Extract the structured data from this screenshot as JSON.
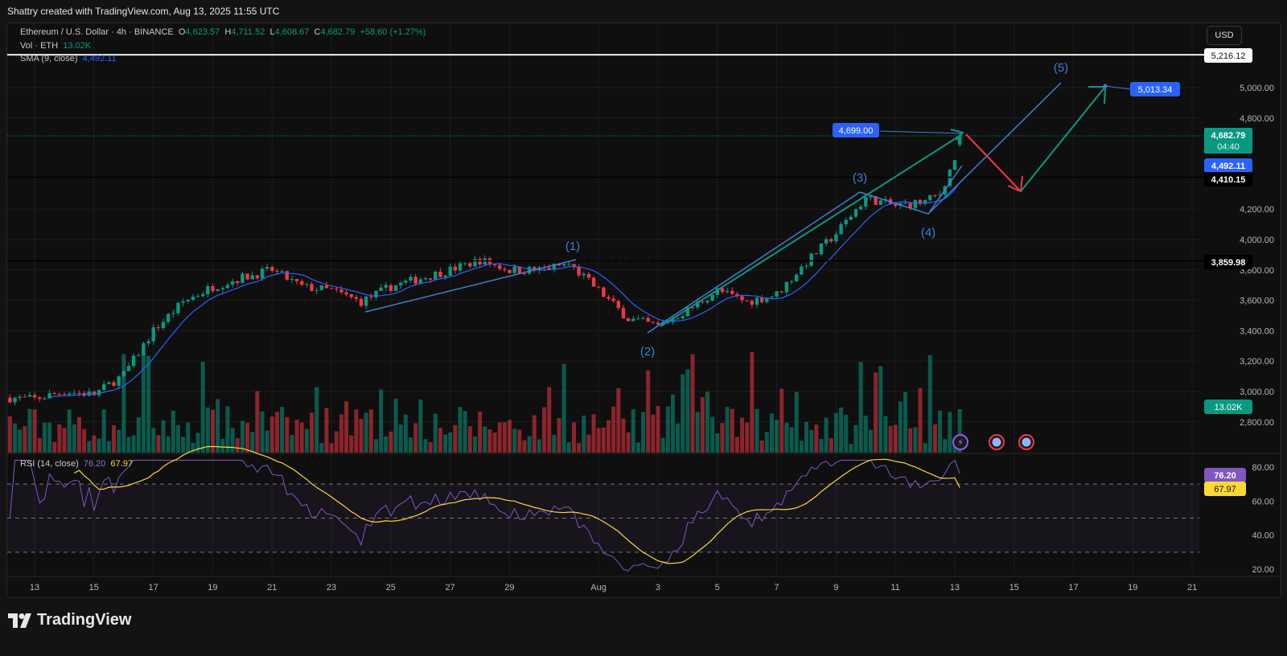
{
  "credit": "Shattry created with TradingView.com, Aug 13, 2025 11:55 UTC",
  "legend": {
    "symbol": "Ethereum / U.S. Dollar · 4h · BINANCE",
    "o_label": "O",
    "o": "4,623.57",
    "h_label": "H",
    "h": "4,711.52",
    "l_label": "L",
    "l": "4,608.67",
    "c_label": "C",
    "c": "4,682.79",
    "change": "+58.60 (+1.27%)",
    "vol_label": "Vol · ETH",
    "vol": "13.02K",
    "sma_label": "SMA (9, close)",
    "sma": "4,492.11",
    "rsi_label": "RSI (14, close)",
    "rsi": "76.20",
    "rsi_ma": "67.97"
  },
  "currency": "USD",
  "price_badges": {
    "top_line": "5,216.12",
    "last": "4,682.79",
    "countdown": "04:40",
    "sma": "4,492.11",
    "level_1": "4,410.15",
    "level_2": "3,859.98",
    "volume": "13.02K",
    "rsi": "76.20",
    "rsi_ma": "67.97"
  },
  "annotations": {
    "swing_high": "Swing high $3,859",
    "target_label": "5,013.34",
    "high_label": "4,699.00",
    "waves": [
      "(1)",
      "(2)",
      "(3)",
      "(4)",
      "(5)"
    ]
  },
  "colors": {
    "up": "#089981",
    "down": "#f23645",
    "sma": "#2962ff",
    "rsi": "#7e57c2",
    "rsi_ma": "#fdd835",
    "wave": "#3d7fd6"
  },
  "chart_data": {
    "type": "candlestick",
    "title": "Ethereum / U.S. Dollar · 4h · BINANCE",
    "ylim": [
      2700,
      5250
    ],
    "y_ticks": [
      "5,000.00",
      "4,800.00",
      "4,200.00",
      "4,000.00",
      "3,800.00",
      "3,600.00",
      "3,400.00",
      "3,200.00",
      "3,000.00",
      "2,800.00"
    ],
    "y_tick_values": [
      5000,
      4800,
      4200,
      4000,
      3800,
      3600,
      3400,
      3200,
      3000,
      2800
    ],
    "x_ticks": [
      "13",
      "15",
      "17",
      "19",
      "21",
      "23",
      "25",
      "27",
      "29",
      "Aug",
      "3",
      "5",
      "7",
      "9",
      "11",
      "13",
      "15",
      "17",
      "19",
      "21"
    ],
    "x_tick_dates": [
      "2025-07-13",
      "2025-07-15",
      "2025-07-17",
      "2025-07-19",
      "2025-07-21",
      "2025-07-23",
      "2025-07-25",
      "2025-07-27",
      "2025-07-29",
      "2025-08-01",
      "2025-08-03",
      "2025-08-05",
      "2025-08-07",
      "2025-08-09",
      "2025-08-11",
      "2025-08-13",
      "2025-08-15",
      "2025-08-17",
      "2025-08-19",
      "2025-08-21"
    ],
    "approx_close_path": [
      [
        "2025-07-12",
        2960
      ],
      [
        "2025-07-13",
        2950
      ],
      [
        "2025-07-14",
        3000
      ],
      [
        "2025-07-15",
        2980
      ],
      [
        "2025-07-16",
        3110
      ],
      [
        "2025-07-17",
        3400
      ],
      [
        "2025-07-18",
        3590
      ],
      [
        "2025-07-19",
        3690
      ],
      [
        "2025-07-20",
        3750
      ],
      [
        "2025-07-21",
        3800
      ],
      [
        "2025-07-22",
        3690
      ],
      [
        "2025-07-23",
        3665
      ],
      [
        "2025-07-24",
        3590
      ],
      [
        "2025-07-25",
        3690
      ],
      [
        "2025-07-26",
        3745
      ],
      [
        "2025-07-27",
        3800
      ],
      [
        "2025-07-28",
        3865
      ],
      [
        "2025-07-29",
        3800
      ],
      [
        "2025-07-30",
        3800
      ],
      [
        "2025-07-31",
        3840
      ],
      [
        "2025-08-01",
        3665
      ],
      [
        "2025-08-02",
        3480
      ],
      [
        "2025-08-03",
        3430
      ],
      [
        "2025-08-04",
        3535
      ],
      [
        "2025-08-05",
        3665
      ],
      [
        "2025-08-06",
        3590
      ],
      [
        "2025-08-07",
        3640
      ],
      [
        "2025-08-08",
        3850
      ],
      [
        "2025-08-09",
        4040
      ],
      [
        "2025-08-10",
        4275
      ],
      [
        "2025-08-11",
        4220
      ],
      [
        "2025-08-12",
        4250
      ],
      [
        "2025-08-12T12:00",
        4300
      ],
      [
        "2025-08-13T08:00",
        4683
      ]
    ],
    "last_candle": {
      "open": 4623.57,
      "high": 4711.52,
      "low": 4608.67,
      "close": 4682.79,
      "volume": "13.02K"
    },
    "rsi": {
      "period": 14,
      "value": 76.2,
      "ma": 67.97,
      "ylim": [
        15,
        85
      ],
      "bands": [
        70,
        50,
        30
      ],
      "y_ticks": [
        "80.00",
        "60.00",
        "40.00",
        "20.00"
      ],
      "y_tick_values": [
        80,
        60,
        40,
        20
      ]
    },
    "sma": {
      "period": 9,
      "value": 4492.11
    },
    "horizontal_levels": [
      5216.12,
      4410.15,
      3859.98
    ],
    "projection": {
      "high": 4699.0,
      "target": 5013.34
    }
  }
}
